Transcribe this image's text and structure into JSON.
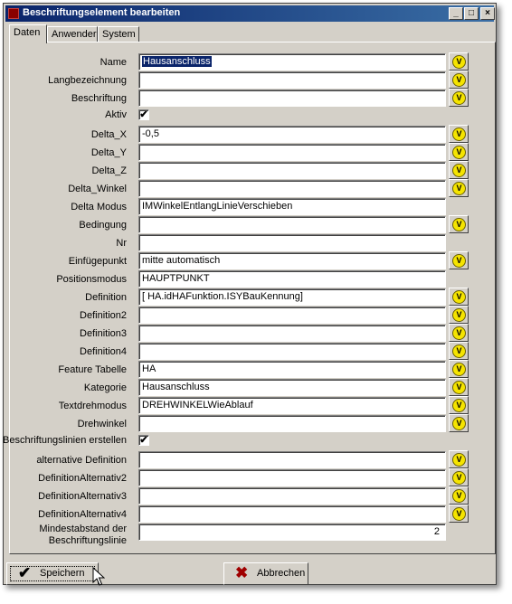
{
  "window": {
    "title": "Beschriftungselement bearbeiten"
  },
  "titlebar": {
    "minimize": "_",
    "maximize": "□",
    "close": "×"
  },
  "tabs": [
    {
      "label": "Daten",
      "active": true
    },
    {
      "label": "Anwender",
      "active": false
    },
    {
      "label": "System",
      "active": false
    }
  ],
  "fields": {
    "name": {
      "label": "Name",
      "value": "Hausanschluss"
    },
    "langbezeichnung": {
      "label": "Langbezeichnung",
      "value": ""
    },
    "beschriftung": {
      "label": "Beschriftung",
      "value": ""
    },
    "aktiv": {
      "label": "Aktiv",
      "checked": true
    },
    "delta_x": {
      "label": "Delta_X",
      "value": "-0,5"
    },
    "delta_y": {
      "label": "Delta_Y",
      "value": ""
    },
    "delta_z": {
      "label": "Delta_Z",
      "value": ""
    },
    "delta_winkel": {
      "label": "Delta_Winkel",
      "value": ""
    },
    "delta_modus": {
      "label": "Delta Modus",
      "value": "IMWinkelEntlangLinieVerschieben"
    },
    "bedingung": {
      "label": "Bedingung",
      "value": ""
    },
    "nr": {
      "label": "Nr",
      "value": ""
    },
    "einfuegepunkt": {
      "label": "Einfügepunkt",
      "value": "mitte automatisch"
    },
    "positionsmodus": {
      "label": "Positionsmodus",
      "value": "HAUPTPUNKT"
    },
    "definition": {
      "label": "Definition",
      "value": "[ HA.idHAFunktion.ISYBauKennung]"
    },
    "definition2": {
      "label": "Definition2",
      "value": ""
    },
    "definition3": {
      "label": "Definition3",
      "value": ""
    },
    "definition4": {
      "label": "Definition4",
      "value": ""
    },
    "feature_tabelle": {
      "label": "Feature Tabelle",
      "value": "HA"
    },
    "kategorie": {
      "label": "Kategorie",
      "value": "Hausanschluss"
    },
    "textdrehmodus": {
      "label": "Textdrehmodus",
      "value": "DREHWINKELWieAblauf"
    },
    "drehwinkel": {
      "label": "Drehwinkel",
      "value": ""
    },
    "beschriftungslinien": {
      "label": "Beschriftungslinien erstellen",
      "checked": true
    },
    "alternative_definition": {
      "label": "alternative Definition",
      "value": ""
    },
    "definition_alternativ2": {
      "label": "DefinitionAlternativ2",
      "value": ""
    },
    "definition_alternativ3": {
      "label": "DefinitionAlternativ3",
      "value": ""
    },
    "definition_alternativ4": {
      "label": "DefinitionAlternativ4",
      "value": ""
    },
    "mindestabstand": {
      "label_line1": "Mindestabstand der",
      "label_line2": "Beschriftungslinie",
      "value": "2"
    }
  },
  "value_button": {
    "glyph": "V"
  },
  "checkbox_glyph": "✔",
  "buttons": {
    "save": {
      "label": "Speichern",
      "icon": "checkmark-icon"
    },
    "cancel": {
      "label": "Abbrechen",
      "icon": "x-cross-icon"
    }
  },
  "colors": {
    "titlebar": "#0a246a",
    "face": "#d4d0c8",
    "value_button": "#f5e400",
    "cancel_icon": "#a00000"
  }
}
